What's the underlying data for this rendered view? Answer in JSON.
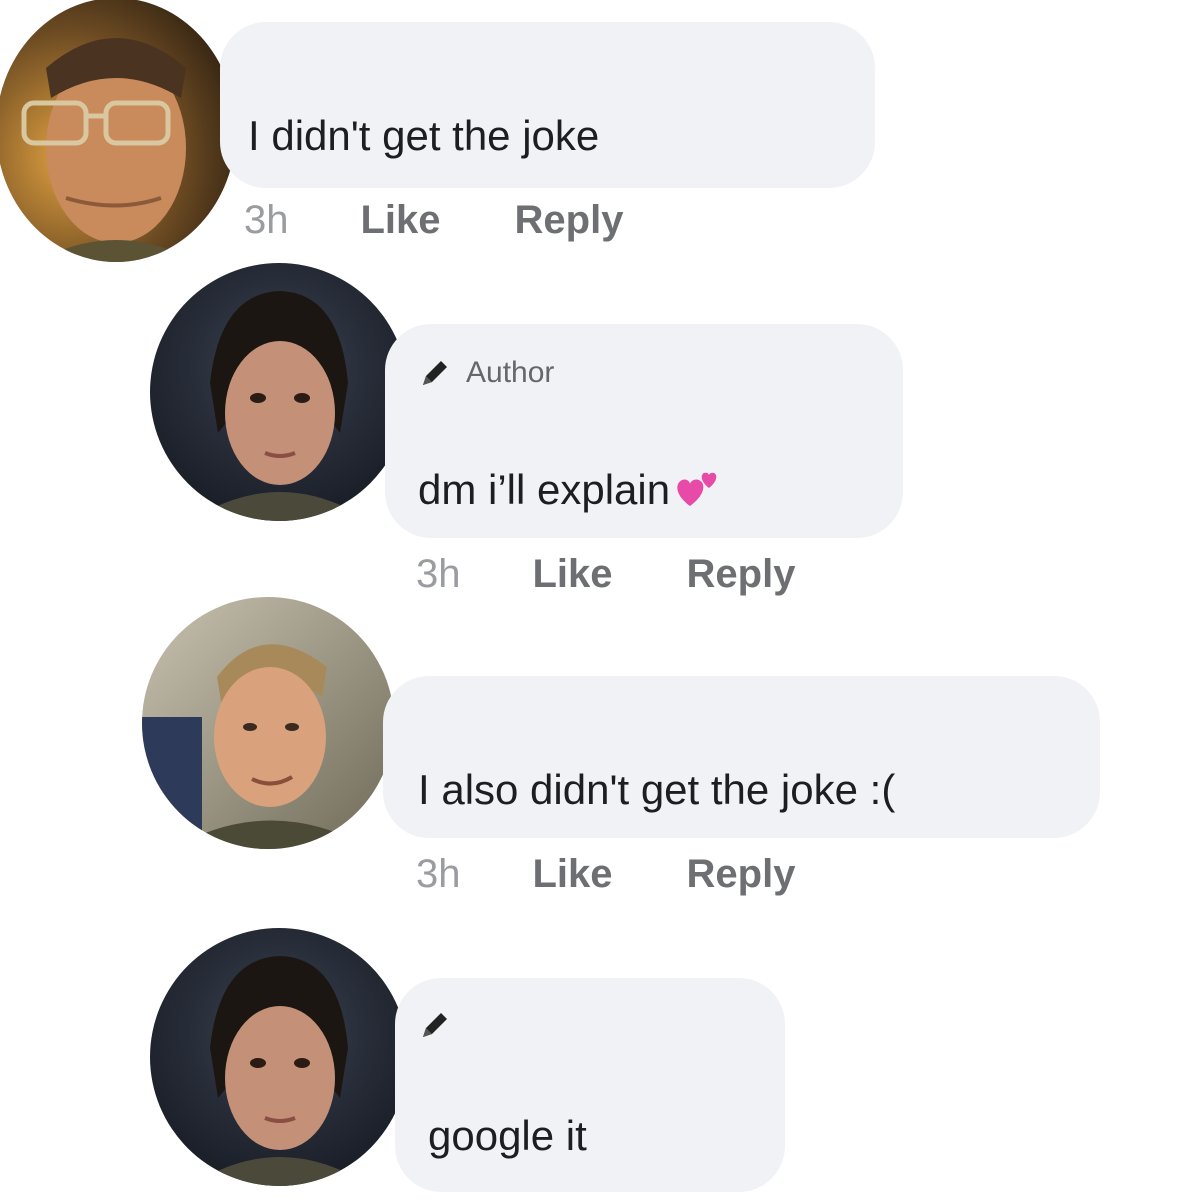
{
  "comments": [
    {
      "avatar": "avatar-man-glasses",
      "text": "I didn't get the joke",
      "time": "3h",
      "like": "Like",
      "reply": "Reply"
    },
    {
      "avatar": "avatar-woman-dark-hair",
      "badge": "Author",
      "badge_icon": "pencil-icon",
      "text": "dm i’ll explain",
      "emoji": "two-hearts-icon",
      "time": "3h",
      "like": "Like",
      "reply": "Reply"
    },
    {
      "avatar": "avatar-man-blond",
      "text": "I also didn't get the joke :(",
      "time": "3h",
      "like": "Like",
      "reply": "Reply"
    },
    {
      "avatar": "avatar-woman-dark-hair",
      "badge_icon": "pencil-icon",
      "text": "google it"
    }
  ],
  "colors": {
    "bubble": "#f1f2f6",
    "text": "#1c1e21",
    "meta": "#65676b",
    "heart": "#e84aa8"
  }
}
